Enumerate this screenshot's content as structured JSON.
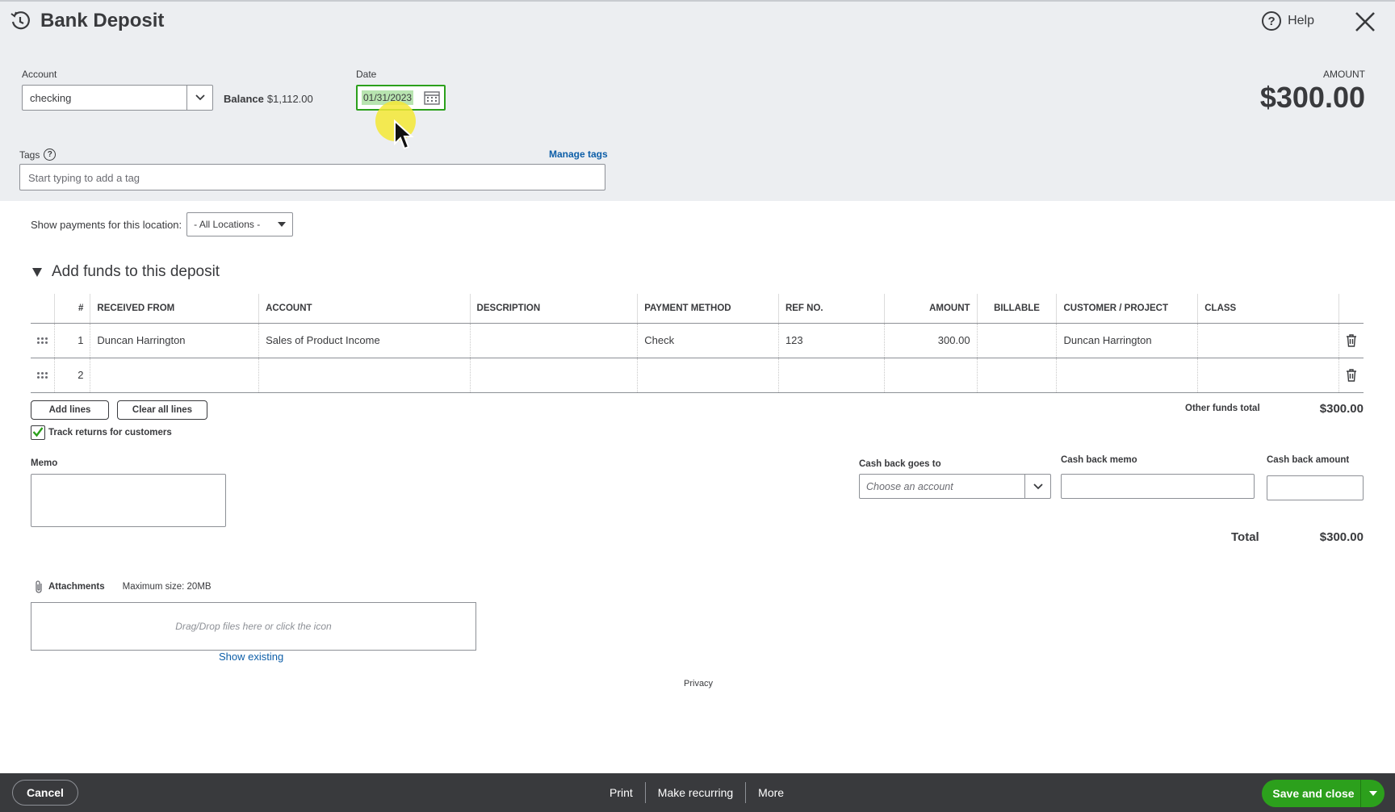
{
  "header": {
    "title": "Bank Deposit",
    "help_label": "Help"
  },
  "account": {
    "label": "Account",
    "value": "checking",
    "balance_label": "Balance",
    "balance_value": "$1,112.00"
  },
  "date": {
    "label": "Date",
    "value": "01/31/2023"
  },
  "amount": {
    "label": "AMOUNT",
    "value": "$300.00"
  },
  "tags": {
    "label": "Tags",
    "manage_label": "Manage tags",
    "placeholder": "Start typing to add a tag"
  },
  "location": {
    "label": "Show payments for this location:",
    "value": "- All Locations -"
  },
  "section": {
    "title": "Add funds to this deposit"
  },
  "table": {
    "columns": [
      "#",
      "RECEIVED FROM",
      "ACCOUNT",
      "DESCRIPTION",
      "PAYMENT METHOD",
      "REF NO.",
      "AMOUNT",
      "BILLABLE",
      "CUSTOMER / PROJECT",
      "CLASS"
    ],
    "rows": [
      {
        "num": "1",
        "received_from": "Duncan Harrington",
        "account": "Sales of Product Income",
        "description": "",
        "payment_method": "Check",
        "ref_no": "123",
        "amount": "300.00",
        "billable": "",
        "customer": "Duncan Harrington",
        "class": ""
      },
      {
        "num": "2",
        "received_from": "",
        "account": "",
        "description": "",
        "payment_method": "",
        "ref_no": "",
        "amount": "",
        "billable": "",
        "customer": "",
        "class": ""
      }
    ]
  },
  "actions": {
    "add_lines": "Add lines",
    "clear_all": "Clear all lines",
    "track_returns": "Track returns for customers",
    "track_returns_checked": true
  },
  "other_funds": {
    "label": "Other funds total",
    "value": "$300.00"
  },
  "memo": {
    "label": "Memo"
  },
  "cash_back": {
    "goes_to_label": "Cash back goes to",
    "goes_to_placeholder": "Choose an account",
    "memo_label": "Cash back memo",
    "amount_label": "Cash back amount"
  },
  "total": {
    "label": "Total",
    "value": "$300.00"
  },
  "attachments": {
    "label": "Attachments",
    "max_size": "Maximum size: 20MB",
    "drop_text": "Drag/Drop files here or click the icon",
    "show_existing": "Show existing"
  },
  "privacy": "Privacy",
  "footer": {
    "cancel": "Cancel",
    "print": "Print",
    "make_recurring": "Make recurring",
    "more": "More",
    "save_close": "Save and close"
  },
  "colors": {
    "accent_green": "#2ca01c",
    "link_blue": "#0d5ea8",
    "footer_bg": "#393a3d",
    "header_bg": "#eceef1"
  }
}
